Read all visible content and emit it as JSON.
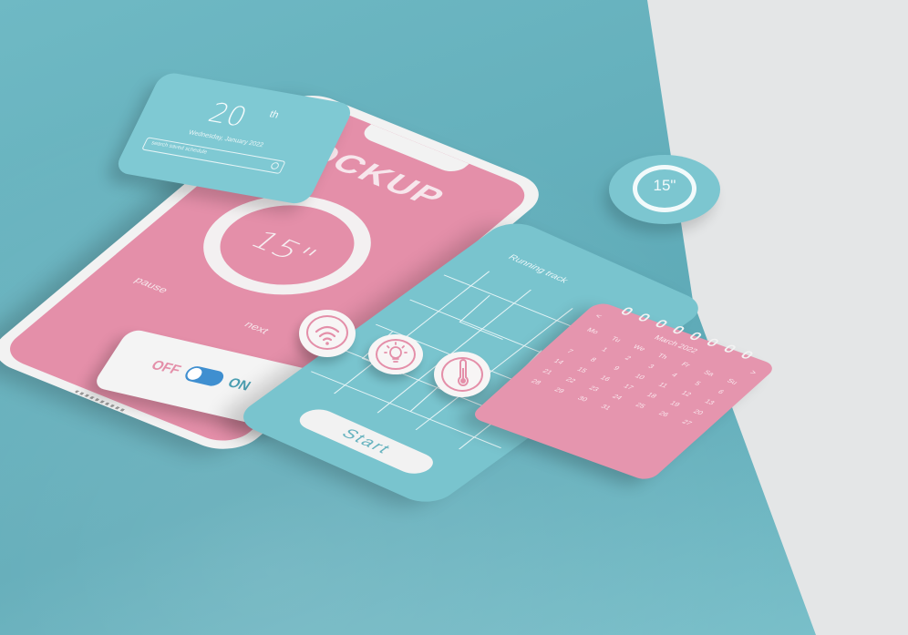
{
  "phone": {
    "title": "MOCKUP",
    "timer": "15\"",
    "pause_label": "pause",
    "next_label": "next"
  },
  "toggle": {
    "off_label": "OFF",
    "on_label": "ON",
    "state": "on"
  },
  "date_card": {
    "day": "20",
    "suffix": "th",
    "date_text": "Wednesday, January 2022",
    "search_placeholder": "search saved schedule"
  },
  "timer_disc": {
    "value": "15\""
  },
  "running": {
    "track_label": "Running track",
    "menu_dots": "⋮",
    "start_label": "Start"
  },
  "calendar": {
    "month": "March 2022",
    "prev": "<",
    "next": ">",
    "weekdays": [
      "Mo",
      "Tu",
      "We",
      "Th",
      "Fr",
      "Sa",
      "Su"
    ],
    "days": [
      "",
      "",
      "",
      "",
      "",
      "",
      "",
      "",
      "",
      "",
      "",
      "",
      "",
      "",
      "",
      "",
      "",
      "",
      "",
      "",
      "",
      "",
      "",
      "",
      "",
      "",
      "",
      "",
      "",
      "",
      "",
      "",
      "",
      "",
      "",
      "",
      "",
      "",
      "",
      "",
      "",
      ""
    ],
    "visible_numbers": [
      "1",
      "2",
      "3",
      "4",
      "5",
      "6",
      "7",
      "8",
      "9",
      "10",
      "11",
      "12",
      "13",
      "14",
      "15",
      "16",
      "17",
      "18",
      "19",
      "20",
      "21",
      "22",
      "23",
      "24",
      "25",
      "26",
      "27",
      "28",
      "29",
      "30",
      "31"
    ]
  },
  "icons": [
    "wifi-icon",
    "lightbulb-icon",
    "thermometer-icon",
    "search-icon"
  ],
  "colors": {
    "pink": "#e48fa9",
    "teal": "#79c4ce",
    "background": "#6fb9c4",
    "switch": "#3f8fd0"
  }
}
